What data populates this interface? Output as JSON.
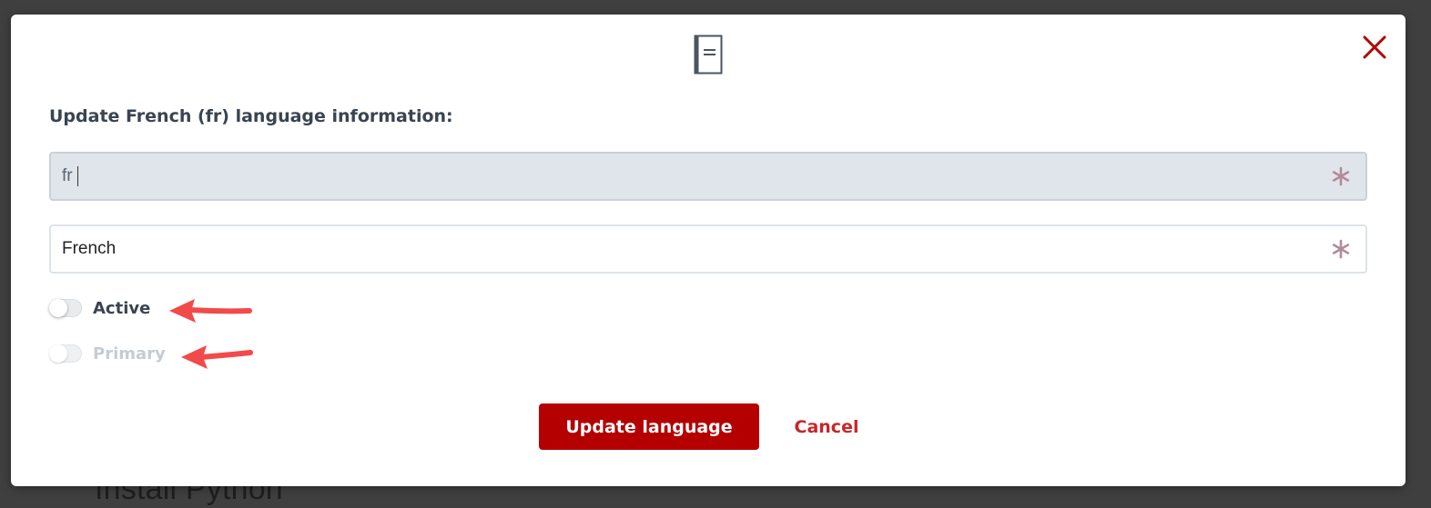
{
  "background": {
    "partial_heading": "Install Python"
  },
  "modal": {
    "header_icon": "document-icon",
    "close_icon": "close-icon",
    "title": "Update French (fr) language information:",
    "code_field": {
      "value": "fr",
      "required": true,
      "disabled": true
    },
    "name_field": {
      "value": "French",
      "required": true
    },
    "toggles": {
      "active": {
        "label": "Active",
        "on": false
      },
      "primary": {
        "label": "Primary",
        "on": false,
        "disabled": true
      }
    },
    "buttons": {
      "update_label": "Update language",
      "cancel_label": "Cancel"
    }
  },
  "annotations": {
    "arrow_color": "#f24a4a"
  },
  "colors": {
    "primary_button": "#b40000",
    "cancel_text": "#c8262a",
    "close_icon": "#b40000",
    "required_asterisk": "#b48a9a"
  }
}
